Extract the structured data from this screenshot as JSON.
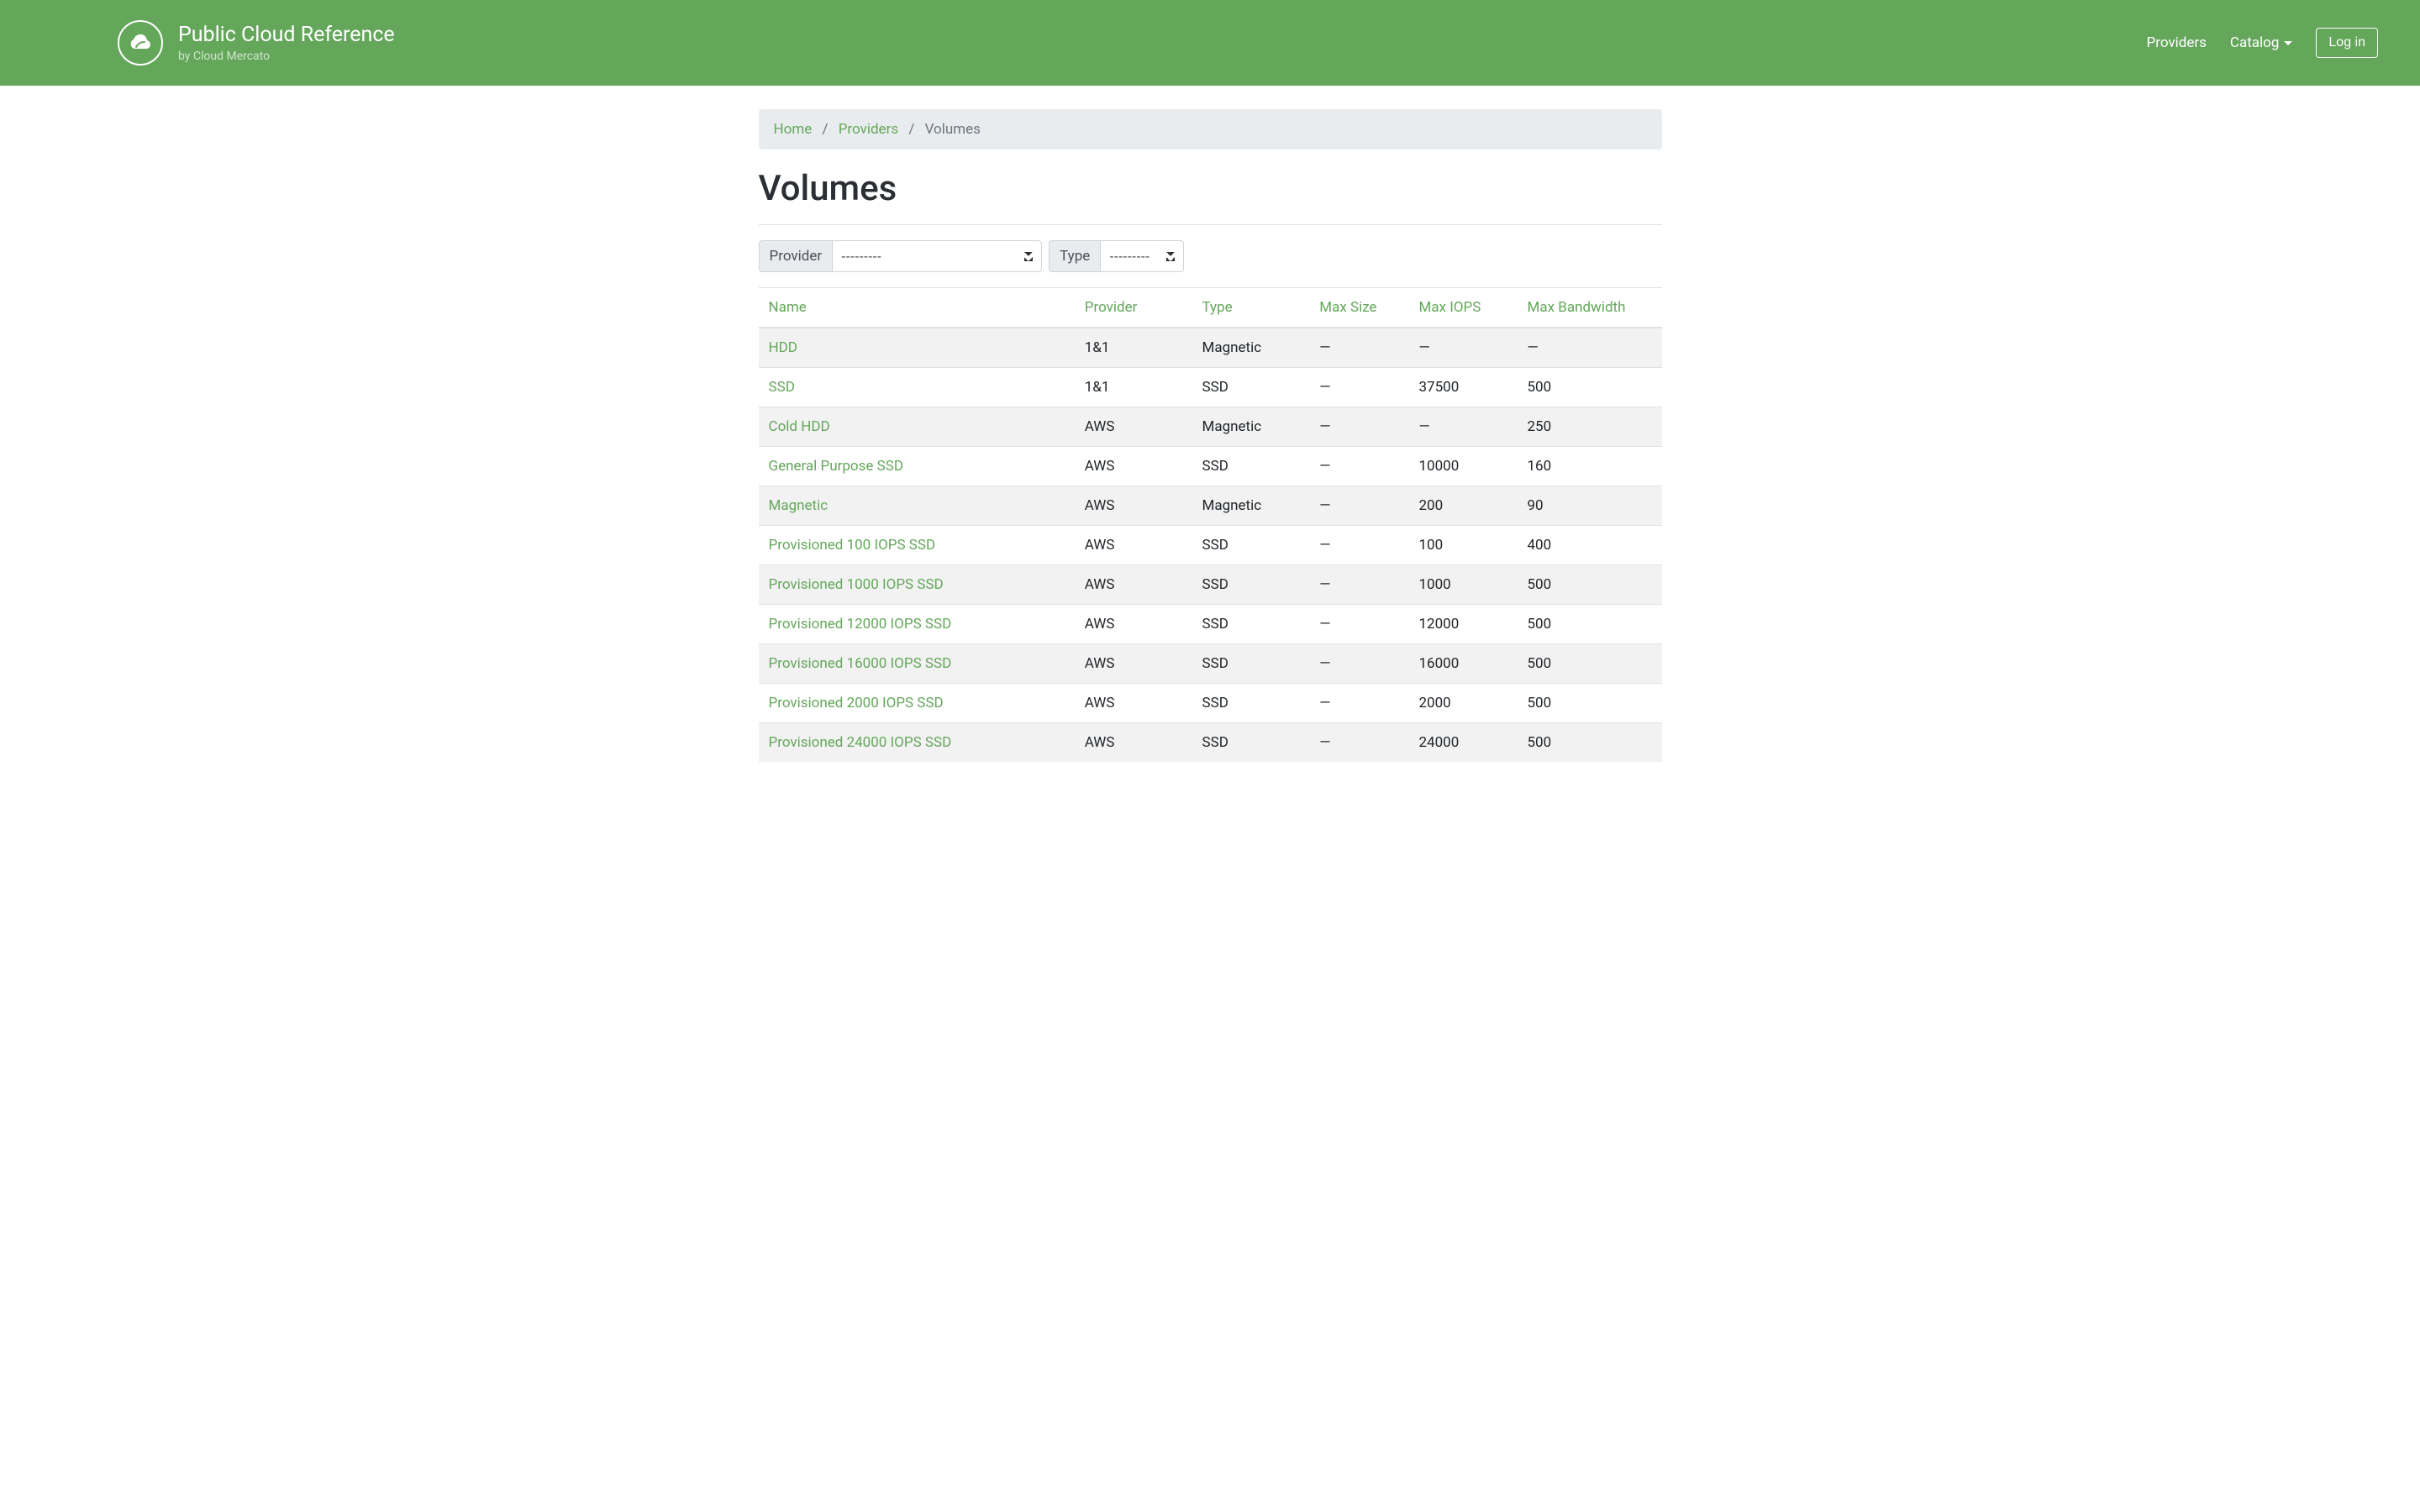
{
  "header": {
    "title": "Public Cloud Reference",
    "subtitle": "by Cloud Mercato",
    "nav": {
      "providers": "Providers",
      "catalog": "Catalog",
      "login": "Log in"
    }
  },
  "breadcrumb": {
    "home": "Home",
    "providers": "Providers",
    "current": "Volumes"
  },
  "page_title": "Volumes",
  "filters": {
    "provider_label": "Provider",
    "provider_selected": "---------",
    "type_label": "Type",
    "type_selected": "---------"
  },
  "table": {
    "headers": {
      "name": "Name",
      "provider": "Provider",
      "type": "Type",
      "max_size": "Max Size",
      "max_iops": "Max IOPS",
      "max_bandwidth": "Max Bandwidth"
    },
    "rows": [
      {
        "name": "HDD",
        "provider": "1&1",
        "type": "Magnetic",
        "max_size": "—",
        "max_iops": "—",
        "max_bandwidth": "—"
      },
      {
        "name": "SSD",
        "provider": "1&1",
        "type": "SSD",
        "max_size": "—",
        "max_iops": "37500",
        "max_bandwidth": "500"
      },
      {
        "name": "Cold HDD",
        "provider": "AWS",
        "type": "Magnetic",
        "max_size": "—",
        "max_iops": "—",
        "max_bandwidth": "250"
      },
      {
        "name": "General Purpose SSD",
        "provider": "AWS",
        "type": "SSD",
        "max_size": "—",
        "max_iops": "10000",
        "max_bandwidth": "160"
      },
      {
        "name": "Magnetic",
        "provider": "AWS",
        "type": "Magnetic",
        "max_size": "—",
        "max_iops": "200",
        "max_bandwidth": "90"
      },
      {
        "name": "Provisioned 100 IOPS SSD",
        "provider": "AWS",
        "type": "SSD",
        "max_size": "—",
        "max_iops": "100",
        "max_bandwidth": "400"
      },
      {
        "name": "Provisioned 1000 IOPS SSD",
        "provider": "AWS",
        "type": "SSD",
        "max_size": "—",
        "max_iops": "1000",
        "max_bandwidth": "500"
      },
      {
        "name": "Provisioned 12000 IOPS SSD",
        "provider": "AWS",
        "type": "SSD",
        "max_size": "—",
        "max_iops": "12000",
        "max_bandwidth": "500"
      },
      {
        "name": "Provisioned 16000 IOPS SSD",
        "provider": "AWS",
        "type": "SSD",
        "max_size": "—",
        "max_iops": "16000",
        "max_bandwidth": "500"
      },
      {
        "name": "Provisioned 2000 IOPS SSD",
        "provider": "AWS",
        "type": "SSD",
        "max_size": "—",
        "max_iops": "2000",
        "max_bandwidth": "500"
      },
      {
        "name": "Provisioned 24000 IOPS SSD",
        "provider": "AWS",
        "type": "SSD",
        "max_size": "—",
        "max_iops": "24000",
        "max_bandwidth": "500"
      }
    ]
  }
}
